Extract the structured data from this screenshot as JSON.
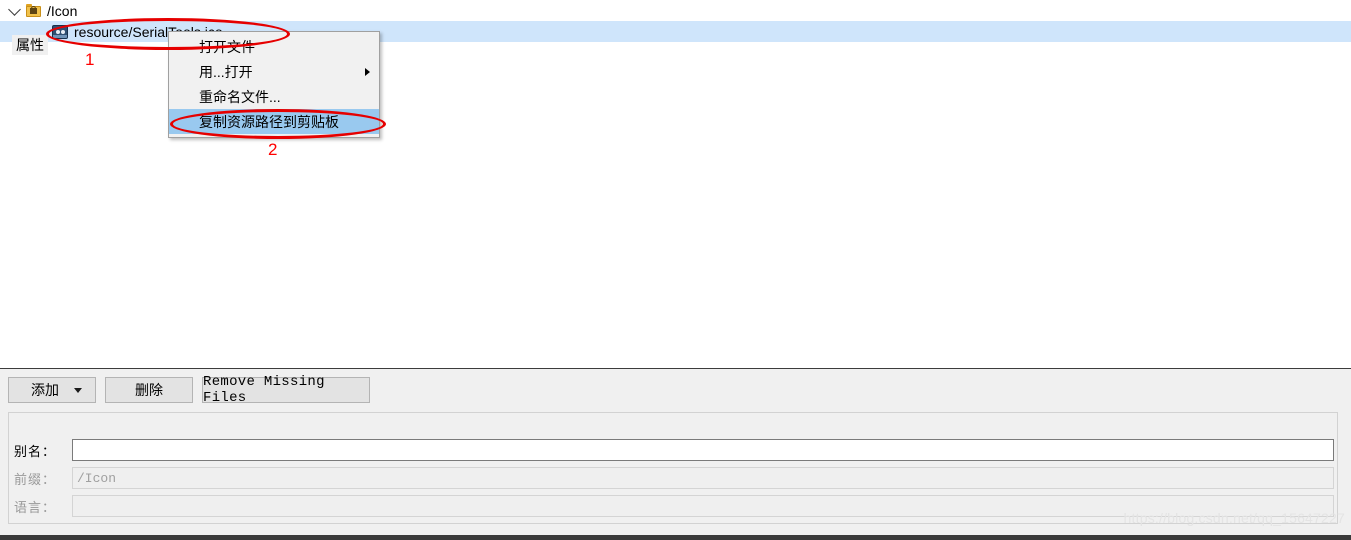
{
  "tree": {
    "root": {
      "label": "/Icon",
      "icon": "locked-folder-icon"
    },
    "child": {
      "label": "resource/SerialTools.ico",
      "icon": "ico-file-icon"
    }
  },
  "context_menu": {
    "items": [
      {
        "label": "打开文件",
        "has_submenu": false,
        "highlighted": false
      },
      {
        "label": "用...打开",
        "has_submenu": true,
        "highlighted": false
      },
      {
        "label": "重命名文件...",
        "has_submenu": false,
        "highlighted": false
      },
      {
        "label": "复制资源路径到剪贴板",
        "has_submenu": false,
        "highlighted": true
      }
    ]
  },
  "annotations": {
    "step1": "1",
    "step2": "2",
    "color": "#ff0000"
  },
  "toolbar": {
    "add_label": "添加",
    "delete_label": "删除",
    "remove_missing_label": "Remove Missing Files"
  },
  "properties": {
    "title": "属性",
    "fields": [
      {
        "label": "别名：",
        "value": "",
        "enabled": true
      },
      {
        "label": "前缀：",
        "value": "/Icon",
        "enabled": false
      },
      {
        "label": "语言：",
        "value": "",
        "enabled": false
      }
    ]
  },
  "watermark": "https://blog.csdn.net/qq_15647227",
  "colors": {
    "tree_selection": "#cfe5fb",
    "menu_highlight": "#99c9ef",
    "panel_bg": "#f0f0f0",
    "annotation_red": "#e60000"
  }
}
